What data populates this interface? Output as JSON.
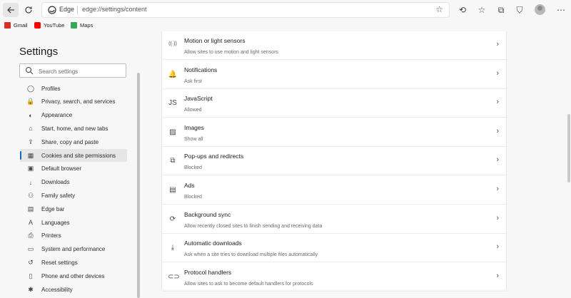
{
  "browser": {
    "brand": "Edge",
    "url": "edge://settings/content"
  },
  "bookmarks": [
    {
      "label": "Gmail",
      "color": "#d93025"
    },
    {
      "label": "YouTube",
      "color": "#ff0000"
    },
    {
      "label": "Maps",
      "color": "#34a853"
    }
  ],
  "sidebar": {
    "title": "Settings",
    "search_placeholder": "Search settings",
    "items": [
      {
        "label": "Profiles",
        "icon": "profile-icon",
        "glyph": "◯"
      },
      {
        "label": "Privacy, search, and services",
        "icon": "lock-icon",
        "glyph": "🔒"
      },
      {
        "label": "Appearance",
        "icon": "appearance-icon",
        "glyph": "◐"
      },
      {
        "label": "Start, home, and new tabs",
        "icon": "home-icon",
        "glyph": "⌂"
      },
      {
        "label": "Share, copy and paste",
        "icon": "share-icon",
        "glyph": "⇪"
      },
      {
        "label": "Cookies and site permissions",
        "icon": "cookies-icon",
        "glyph": "▦",
        "active": true
      },
      {
        "label": "Default browser",
        "icon": "browser-icon",
        "glyph": "▣"
      },
      {
        "label": "Downloads",
        "icon": "download-icon",
        "glyph": "↓"
      },
      {
        "label": "Family safety",
        "icon": "family-icon",
        "glyph": "⚇"
      },
      {
        "label": "Edge bar",
        "icon": "edge-bar-icon",
        "glyph": "▤"
      },
      {
        "label": "Languages",
        "icon": "language-icon",
        "glyph": "A"
      },
      {
        "label": "Printers",
        "icon": "printer-icon",
        "glyph": "⎙"
      },
      {
        "label": "System and performance",
        "icon": "system-icon",
        "glyph": "▭"
      },
      {
        "label": "Reset settings",
        "icon": "reset-icon",
        "glyph": "↺"
      },
      {
        "label": "Phone and other devices",
        "icon": "phone-icon",
        "glyph": "▯"
      },
      {
        "label": "Accessibility",
        "icon": "accessibility-icon",
        "glyph": "✱"
      }
    ]
  },
  "permissions": [
    {
      "title": "Motion or light sensors",
      "subtitle": "Allow sites to use motion and light sensors",
      "icon": "sensor-icon",
      "glyph": "((·))"
    },
    {
      "title": "Notifications",
      "subtitle": "Ask first",
      "icon": "bell-icon",
      "glyph": "🔔"
    },
    {
      "title": "JavaScript",
      "subtitle": "Allowed",
      "icon": "javascript-icon",
      "glyph": "JS"
    },
    {
      "title": "Images",
      "subtitle": "Show all",
      "icon": "image-icon",
      "glyph": "▨"
    },
    {
      "title": "Pop-ups and redirects",
      "subtitle": "Blocked",
      "icon": "popup-icon",
      "glyph": "⧉"
    },
    {
      "title": "Ads",
      "subtitle": "Blocked",
      "icon": "ads-icon",
      "glyph": "▤"
    },
    {
      "title": "Background sync",
      "subtitle": "Allow recently closed sites to finish sending and receiving data",
      "icon": "sync-icon",
      "glyph": "⟳"
    },
    {
      "title": "Automatic downloads",
      "subtitle": "Ask when a site tries to download multiple files automatically",
      "icon": "download-icon",
      "glyph": "⤓"
    },
    {
      "title": "Protocol handlers",
      "subtitle": "Allow sites to ask to become default handlers for protocols",
      "icon": "link-icon",
      "glyph": "⊂⊃"
    }
  ],
  "colors": {
    "accent": "#0f6cbd"
  }
}
